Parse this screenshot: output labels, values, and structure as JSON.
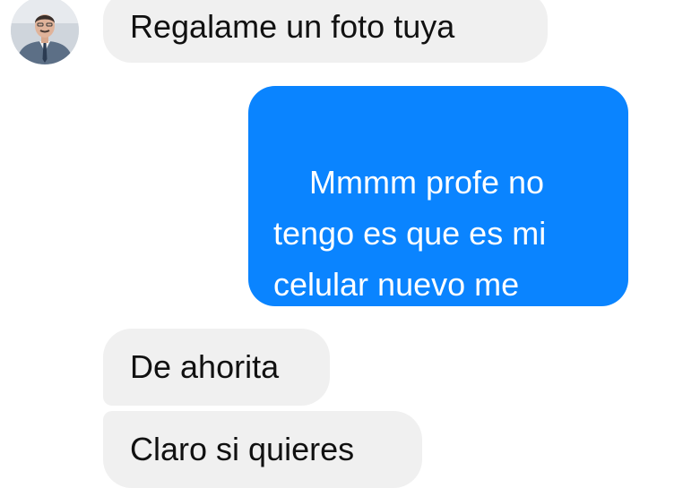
{
  "conversation": {
    "contact_avatar_icon": "person-in-suit-avatar",
    "messages": [
      {
        "sender": "contact",
        "text": "Regalame un foto tuya"
      },
      {
        "sender": "me",
        "text": "Mmmm profe no\ntengo es que es mi\ncelular nuevo me\nrobaron el otro"
      },
      {
        "sender": "contact",
        "text": "De ahorita"
      },
      {
        "sender": "contact",
        "text": "Claro si quieres"
      }
    ]
  },
  "colors": {
    "incoming_bubble": "#f0f0f0",
    "outgoing_bubble": "#0a84ff",
    "incoming_text": "#111111",
    "outgoing_text": "#ffffff"
  }
}
